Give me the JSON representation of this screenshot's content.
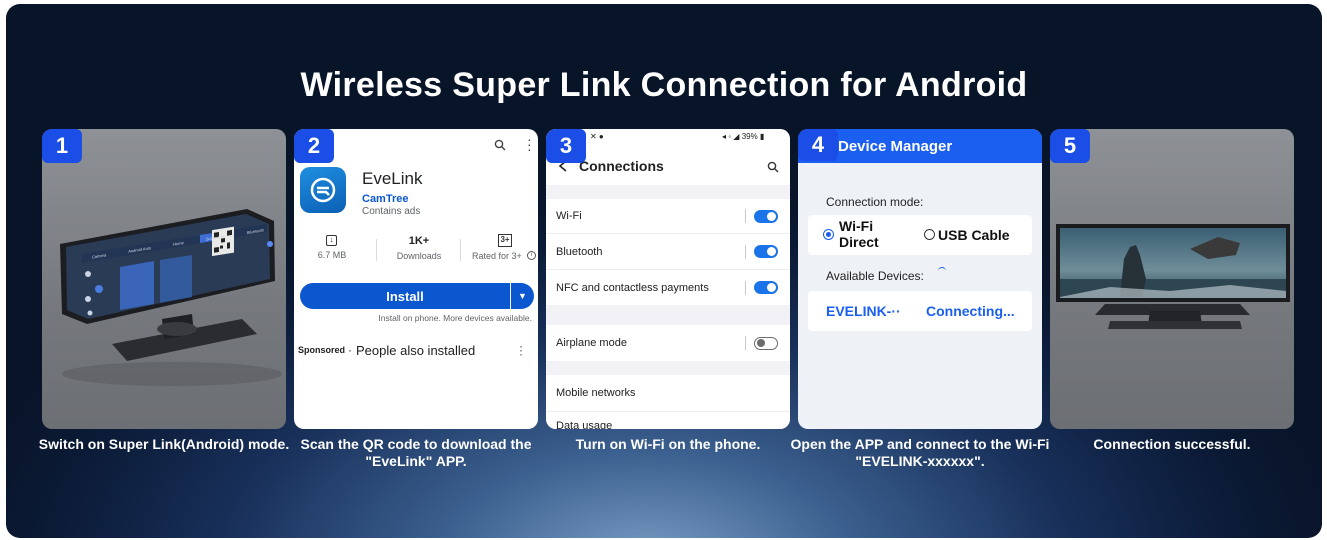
{
  "title": "Wireless Super Link Connection for Android",
  "steps": [
    {
      "number": "1",
      "caption": "Switch on Super Link(Android) mode."
    },
    {
      "number": "2",
      "caption": "Scan the QR code to download the \"EveLink\" APP."
    },
    {
      "number": "3",
      "caption": "Turn on  Wi-Fi on the phone."
    },
    {
      "number": "4",
      "caption": "Open the APP and connect to the Wi-Fi \"EVELINK-xxxxxx\"."
    },
    {
      "number": "5",
      "caption": "Connection successful."
    }
  ],
  "device_screen": {
    "tabs": [
      "Camera",
      "Android Auto",
      "Home",
      "Super Link",
      "Bluetooth"
    ]
  },
  "play_store": {
    "app_name": "EveLink",
    "developer": "CamTree",
    "ads_note": "Contains ads",
    "size": "6.7 MB",
    "downloads_value": "1K+",
    "downloads_label": "Downloads",
    "rating_badge": "3+",
    "rating_label": "Rated for 3+",
    "install_label": "Install",
    "install_note": "Install on phone. More devices available.",
    "sponsored_label": "Sponsored",
    "people_installed": "People also installed"
  },
  "settings": {
    "status_right": "39%",
    "header": "Connections",
    "rows": [
      {
        "label": "Wi-Fi",
        "state": "on"
      },
      {
        "label": "Bluetooth",
        "state": "on"
      },
      {
        "label": "NFC and contactless payments",
        "state": "on"
      },
      {
        "label": "Airplane mode",
        "state": "off"
      },
      {
        "label": "Mobile networks",
        "state": "none"
      },
      {
        "label": "Data usage",
        "state": "none"
      }
    ]
  },
  "device_manager": {
    "header": "Device Manager",
    "connection_mode_label": "Connection mode:",
    "option_wifi_line1": "Wi-Fi",
    "option_wifi_line2": "Direct",
    "option_usb": "USB Cable",
    "available_label": "Available Devices:",
    "device_name": "EVELINK-··",
    "device_status": "Connecting..."
  },
  "colors": {
    "badge_blue": "#1a4ee6",
    "install_blue": "#0b57d0",
    "header_blue": "#1a5ff0",
    "toggle_blue": "#1a73e8"
  }
}
